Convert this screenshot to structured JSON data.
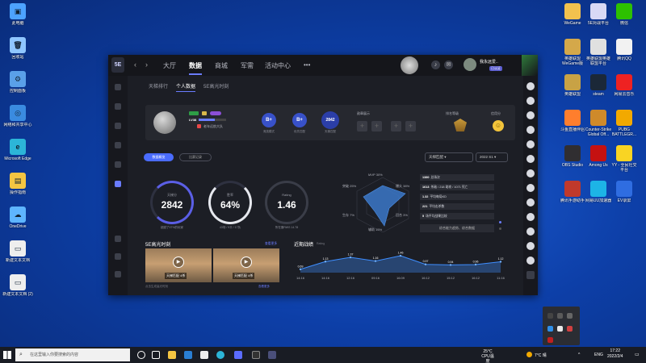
{
  "desktop_left": [
    {
      "label": "此电脑",
      "color": "#4da3ff",
      "glyph": "▣"
    },
    {
      "label": "回收站",
      "color": "#8fc6ff",
      "glyph": "🗑"
    },
    {
      "label": "控制面板",
      "color": "#5aa0e8",
      "glyph": "⚙"
    },
    {
      "label": "网络和共享中心",
      "color": "#3a8be0",
      "glyph": "◎"
    },
    {
      "label": "Microsoft Edge",
      "color": "#2cb5d8",
      "glyph": "e"
    },
    {
      "label": "操作指南",
      "color": "#f4c542",
      "glyph": "▤"
    },
    {
      "label": "OneDrive",
      "color": "#5eb5ff",
      "glyph": "☁"
    },
    {
      "label": "新建文本文档",
      "color": "#eeeeee",
      "glyph": "▭"
    },
    {
      "label": "新建文本文档 (2)",
      "color": "#eeeeee",
      "glyph": "▭"
    }
  ],
  "desktop_right": [
    {
      "label": "WeGame",
      "color": "#f2c14e"
    },
    {
      "label": "5E对战平台",
      "color": "#d9d9f5"
    },
    {
      "label": "微信",
      "color": "#2dc100"
    },
    {
      "label": "英雄联盟WeGame版",
      "color": "#d4a84a"
    },
    {
      "label": "英雄联盟英雄联盟平台",
      "color": "#e0e0e0"
    },
    {
      "label": "腾讯QQ",
      "color": "#f2f2f2"
    },
    {
      "label": "英雄联盟",
      "color": "#c8a245"
    },
    {
      "label": "steam",
      "color": "#1b2838"
    },
    {
      "label": "网易云音乐",
      "color": "#e22"
    },
    {
      "label": "斗鱼直播伴侣",
      "color": "#ff7e2d"
    },
    {
      "label": "Counter-Strike Global Off...",
      "color": "#cf8a2a"
    },
    {
      "label": "PUBG BATTLEGR...",
      "color": "#f2a900"
    },
    {
      "label": "OBS Studio",
      "color": "#302e31"
    },
    {
      "label": "Among Us",
      "color": "#c51111"
    },
    {
      "label": "YY - 全民社交平台",
      "color": "#f9d423"
    },
    {
      "label": "腾讯手游助手",
      "color": "#c0392b"
    },
    {
      "label": "网易UU加速器",
      "color": "#1db4e6"
    },
    {
      "label": "EV录屏",
      "color": "#2f6de1"
    }
  ],
  "app": {
    "nav": {
      "back": "‹",
      "forward": "›",
      "tabs": [
        "大厅",
        "数据",
        "商城",
        "军需",
        "活动中心",
        "•••"
      ]
    },
    "user": {
      "name": "我永远爱..",
      "badge": "已认证"
    },
    "subtabs": [
      "天梯排行",
      "个人数据",
      "5E高光时刻"
    ],
    "profile": {
      "level": "LV38",
      "team": "老年远航大队",
      "ranks": [
        {
          "value": "B+",
          "label": "竞技模式"
        },
        {
          "value": "B+",
          "label": "优先匹配"
        },
        {
          "value": "2842",
          "label": "天梯匹配"
        }
      ],
      "medals_label": "勋章展示",
      "rank_label": "排名等级",
      "contrib_label": "信用分"
    },
    "filters": {
      "overview": "数据概览",
      "history": "比赛记录",
      "mode": "天梯匹配",
      "season": "2022 S1"
    },
    "rings": [
      {
        "title": "天梯分",
        "value": "2842",
        "sub": "超越了97%的玩家"
      },
      {
        "title": "胜率",
        "value": "64%",
        "sub": "43场 / 9平 / 17负"
      },
      {
        "title": "Rating",
        "value": "1.46",
        "sub": "所在服RWS 14.78"
      }
    ],
    "radar": {
      "labels": [
        {
          "name": "MVP",
          "val": "30%"
        },
        {
          "name": "爆头",
          "val": "38%"
        },
        {
          "name": "回合",
          "val": "3%"
        },
        {
          "name": "辅助",
          "val": "15%"
        },
        {
          "name": "生存",
          "val": "7%"
        },
        {
          "name": "突破",
          "val": "25%"
        }
      ]
    },
    "stats": [
      {
        "num": "1380",
        "label": "总场次"
      },
      {
        "num": "1613",
        "label": "杀敌 / 218 助攻 / 1071 死亡"
      },
      {
        "num": "1.32",
        "label": "平均每局KD"
      },
      {
        "num": "221",
        "label": "平均击杀数"
      },
      {
        "num": "5",
        "label": "场平均战果比较"
      }
    ],
    "stats_btn": "综合能力趋势、综合数据",
    "highlights": {
      "title": "5E高光时刻",
      "more": "查看更多",
      "videos": [
        {
          "caption": "天梯匹配 4杀"
        },
        {
          "caption": "天梯匹配 4杀"
        }
      ],
      "footer_left": "点击生成高光时刻",
      "footer_right": "查看更多"
    },
    "recent": {
      "title": "近期战绩",
      "subtitle": "Rating"
    }
  },
  "chart_data": {
    "type": "line",
    "title": "近期战绩",
    "x": [
      "14:16",
      "14:16",
      "12:16",
      "09:16",
      "16:09",
      "16:12",
      "15:12",
      "16:12",
      "11:16"
    ],
    "y": [
      0.69,
      1.13,
      1.37,
      1.16,
      1.46,
      0.97,
      0.94,
      0.96,
      1.12
    ],
    "color": "#3e8eff"
  },
  "taskbar": {
    "search_placeholder": "在这里输入你要搜索的内容",
    "weather": "25°C",
    "weather_sub": "CPU温度",
    "temp": "7°C 晴",
    "lang": "ENG",
    "time": "17:22",
    "date": "2022/2/4"
  }
}
